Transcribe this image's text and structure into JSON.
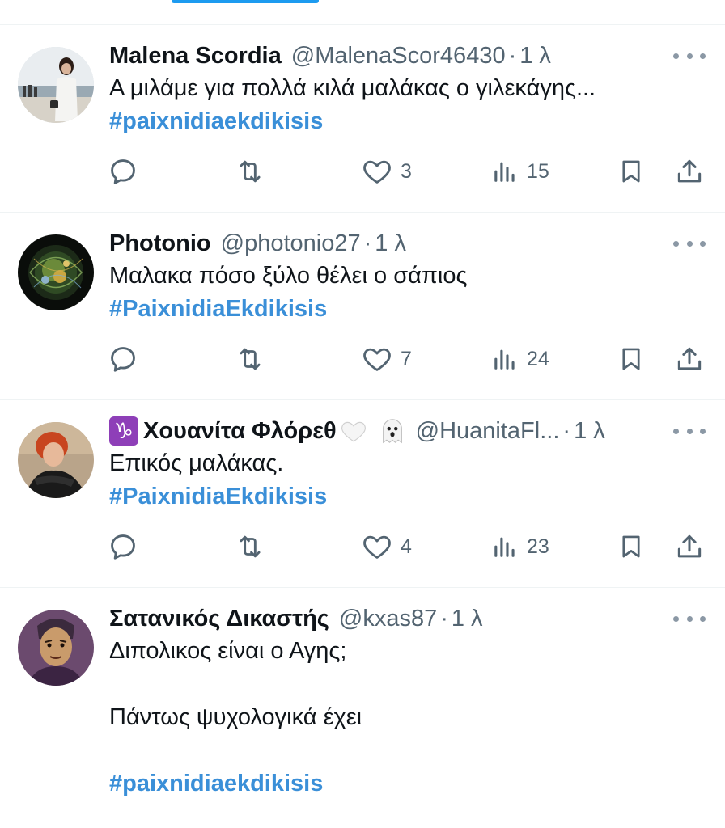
{
  "tweets": [
    {
      "name": "Malena Scordia",
      "handle": "@MalenaScor46430",
      "dot": "·",
      "time": "1 λ",
      "text": "Α μιλάμε για πολλά κιλά μαλάκας ο γιλεκάγης...",
      "hashtag": "#paixnidiaekdikisis",
      "replies": "",
      "retweets": "",
      "likes": "3",
      "views": "15"
    },
    {
      "name": "Photonio",
      "handle": "@photonio27",
      "dot": "·",
      "time": "1 λ",
      "text": "Μαλακα πόσο ξύλο θέλει ο σάπιος",
      "hashtag": "#PaixnidiaEkdikisis",
      "replies": "",
      "retweets": "",
      "likes": "7",
      "views": "24"
    },
    {
      "name_emoji": "♑",
      "name": "Χουανίτα Φλόρεθ",
      "handle": "@HuanitaFl...",
      "dot": "·",
      "time": "1 λ",
      "text": "Επικός μαλάκας.",
      "hashtag": "#PaixnidiaEkdikisis",
      "replies": "",
      "retweets": "",
      "likes": "4",
      "views": "23"
    },
    {
      "name": "Σατανικός Δικαστής",
      "handle": "@kxas87",
      "dot": "·",
      "time": "1 λ",
      "text_line1": "Διπολικος είναι ο Αγης;",
      "text_line2": "Πάντως ψυχολογικά έχει",
      "hashtag": "#paixnidiaekdikisis"
    }
  ],
  "icons": {
    "reply": "reply-icon",
    "retweet": "retweet-icon",
    "like": "heart-icon",
    "views": "views-icon",
    "bookmark": "bookmark-icon",
    "share": "share-icon",
    "more": "more-icon"
  },
  "colors": {
    "accent": "#1d9bf0",
    "hashtag": "#3a8fd8",
    "secondary_text": "#536471",
    "divider": "#eff3f4"
  }
}
